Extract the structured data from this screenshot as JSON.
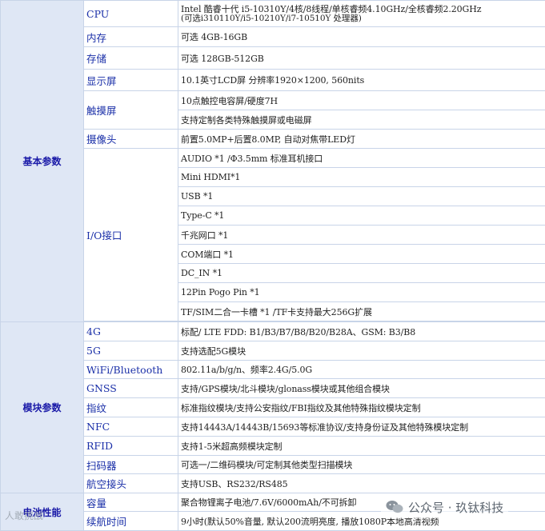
{
  "groups": {
    "basic": "基本参数",
    "module": "模块参数",
    "battery": "电池性能"
  },
  "rows": {
    "cpu": {
      "label": "CPU",
      "value": "Intel 酷睿十代 i5-10310Y/4核/8线程/单核睿频4.10GHz/全核睿频2.20GHz",
      "note": "(可选i310110Y/i5-10210Y/i7-10510Y 处理器)"
    },
    "memory": {
      "label": "内存",
      "value": "可选 4GB-16GB"
    },
    "storage": {
      "label": "存储",
      "value": "可选 128GB-512GB"
    },
    "display": {
      "label": "显示屏",
      "value": "10.1英寸LCD屏 分辨率1920×1200, 560nits"
    },
    "touch": {
      "label": "触摸屏",
      "values": [
        "10点触控电容屏/硬度7H",
        "支持定制各类特殊触摸屏或电磁屏"
      ]
    },
    "camera": {
      "label": "摄像头",
      "value": "前置5.0MP+后置8.0MP, 自动对焦带LED灯"
    },
    "io": {
      "label": "I/O接口",
      "values": [
        "AUDIO *1  /Φ3.5mm 标准耳机接口",
        "Mini HDMI*1",
        "USB *1",
        "Type-C *1",
        "千兆网口 *1",
        "COM端口 *1",
        "DC_IN *1",
        "12Pin Pogo Pin *1",
        "TF/SIM二合一卡槽 *1 /TF卡支持最大256G扩展"
      ]
    },
    "4g": {
      "label": "4G",
      "value": "标配/ LTE FDD: B1/B3/B7/B8/B20/B28A、GSM: B3/B8"
    },
    "5g": {
      "label": "5G",
      "value": "支持选配5G模块"
    },
    "wifi": {
      "label": "WiFi/Bluetooth",
      "value": "802.11a/b/g/n、频率2.4G/5.0G"
    },
    "gnss": {
      "label": "GNSS",
      "value": "支持/GPS模块/北斗模块/glonass模块或其他组合模块"
    },
    "fingerprint": {
      "label": "指纹",
      "value": "标准指纹模块/支持公安指纹/FBI指纹及其他特殊指纹模块定制"
    },
    "nfc": {
      "label": "NFC",
      "value": "支持14443A/14443B/15693等标准协议/支持身份证及其他特殊模块定制"
    },
    "rfid": {
      "label": "RFID",
      "value": "支持1-5米超高频模块定制"
    },
    "scanner": {
      "label": "扫码器",
      "value": "可选一/二维码模块/可定制其他类型扫描模块"
    },
    "aviation": {
      "label": "航空接头",
      "value": "支持USB、RS232/RS485"
    },
    "capacity": {
      "label": "容量",
      "value": "聚合物锂离子电池/7.6V/6000mAh/不可拆卸"
    },
    "endurance": {
      "label": "续航时间",
      "value": "9小时(默认50%音量, 默认200流明亮度, 播放1080P本地高清视频"
    }
  },
  "watermark": {
    "text": "公众号 · 玖钛科技",
    "corner": "人敢挑战"
  },
  "colors": {
    "group_bg": "#dfe7f5",
    "label_text": "#1a2fa8",
    "border": "#c8d4e8"
  }
}
